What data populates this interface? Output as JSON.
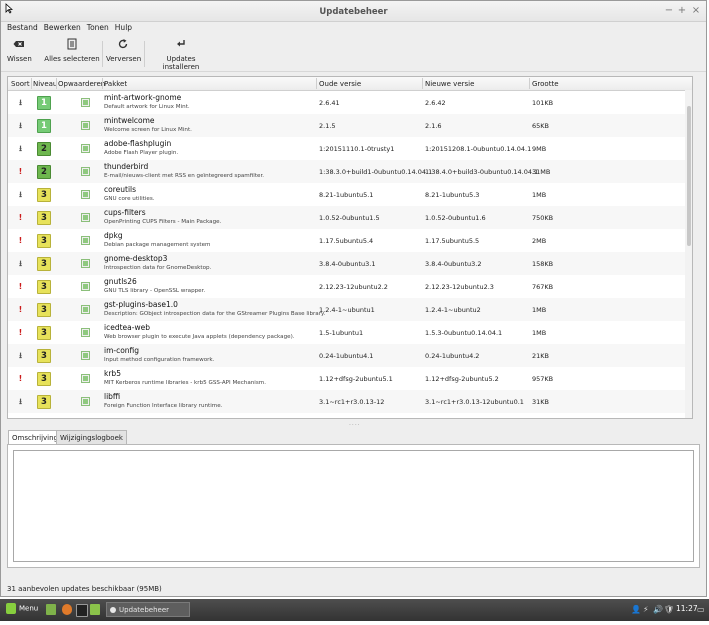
{
  "window": {
    "title": "Updatebeheer",
    "controls": [
      "−",
      "+",
      "×"
    ]
  },
  "menu": [
    "Bestand",
    "Bewerken",
    "Tonen",
    "Hulp"
  ],
  "toolbar": {
    "clear": "Wissen",
    "select_all": "Alles selecteren",
    "refresh": "Verversen",
    "install": "Updates installeren"
  },
  "columns": {
    "type": "Soort",
    "level": "Niveau",
    "upgrade": "Opwaarderen",
    "package": "Pakket",
    "old_version": "Oude versie",
    "new_version": "Nieuwe versie",
    "size": "Grootte"
  },
  "updates": [
    {
      "type": "package",
      "level": "1",
      "name": "mint-artwork-gnome",
      "desc": "Default artwork for Linux Mint.",
      "old": "2.6.41",
      "new": "2.6.42",
      "size": "101KB"
    },
    {
      "type": "package",
      "level": "1",
      "name": "mintwelcome",
      "desc": "Welcome screen for Linux Mint.",
      "old": "2.1.5",
      "new": "2.1.6",
      "size": "65KB"
    },
    {
      "type": "package",
      "level": "2",
      "name": "adobe-flashplugin",
      "desc": "Adobe Flash Player plugin.",
      "old": "1:20151110.1-0trusty1",
      "new": "1:20151208.1-0ubuntu0.14.04.1",
      "size": "9MB"
    },
    {
      "type": "security",
      "level": "2",
      "name": "thunderbird",
      "desc": "E-mail/nieuws-client met RSS en geïntegreerd spamfilter.",
      "old": "1:38.3.0+build1-0ubuntu0.14.04.1",
      "new": "1:38.4.0+build3-0ubuntu0.14.04.1",
      "size": "31MB"
    },
    {
      "type": "package",
      "level": "3",
      "name": "coreutils",
      "desc": "GNU core utilities.",
      "old": "8.21-1ubuntu5.1",
      "new": "8.21-1ubuntu5.3",
      "size": "1MB"
    },
    {
      "type": "security",
      "level": "3",
      "name": "cups-filters",
      "desc": "OpenPrinting CUPS Filters - Main Package.",
      "old": "1.0.52-0ubuntu1.5",
      "new": "1.0.52-0ubuntu1.6",
      "size": "750KB"
    },
    {
      "type": "security",
      "level": "3",
      "name": "dpkg",
      "desc": "Debian package management system",
      "old": "1.17.5ubuntu5.4",
      "new": "1.17.5ubuntu5.5",
      "size": "2MB"
    },
    {
      "type": "package",
      "level": "3",
      "name": "gnome-desktop3",
      "desc": "Introspection data for GnomeDesktop.",
      "old": "3.8.4-0ubuntu3.1",
      "new": "3.8.4-0ubuntu3.2",
      "size": "158KB"
    },
    {
      "type": "security",
      "level": "3",
      "name": "gnutls26",
      "desc": "GNU TLS library - OpenSSL wrapper.",
      "old": "2.12.23-12ubuntu2.2",
      "new": "2.12.23-12ubuntu2.3",
      "size": "767KB"
    },
    {
      "type": "security",
      "level": "3",
      "name": "gst-plugins-base1.0",
      "desc": "Description: GObject introspection data for the GStreamer Plugins Base library.",
      "old": "1.2.4-1~ubuntu1",
      "new": "1.2.4-1~ubuntu2",
      "size": "1MB"
    },
    {
      "type": "security",
      "level": "3",
      "name": "icedtea-web",
      "desc": "Web browser plugin to execute Java applets (dependency package).",
      "old": "1.5-1ubuntu1",
      "new": "1.5.3-0ubuntu0.14.04.1",
      "size": "1MB"
    },
    {
      "type": "package",
      "level": "3",
      "name": "im-config",
      "desc": "Input method configuration framework.",
      "old": "0.24-1ubuntu4.1",
      "new": "0.24-1ubuntu4.2",
      "size": "21KB"
    },
    {
      "type": "security",
      "level": "3",
      "name": "krb5",
      "desc": "MIT Kerberos runtime libraries - krb5 GSS-API Mechanism.",
      "old": "1.12+dfsg-2ubuntu5.1",
      "new": "1.12+dfsg-2ubuntu5.2",
      "size": "957KB"
    },
    {
      "type": "package",
      "level": "3",
      "name": "libffi",
      "desc": "Foreign Function Interface library runtime.",
      "old": "3.1~rc1+r3.0.13-12",
      "new": "3.1~rc1+r3.0.13-12ubuntu0.1",
      "size": "31KB"
    }
  ],
  "tabs": {
    "description": "Omschrijving",
    "changelog": "Wijzigingslogboek"
  },
  "status": "31 aanbevolen updates beschikbaar (95MB)",
  "taskbar": {
    "menu": "Menu",
    "task": "Updatebeheer",
    "clock": "11:27"
  }
}
